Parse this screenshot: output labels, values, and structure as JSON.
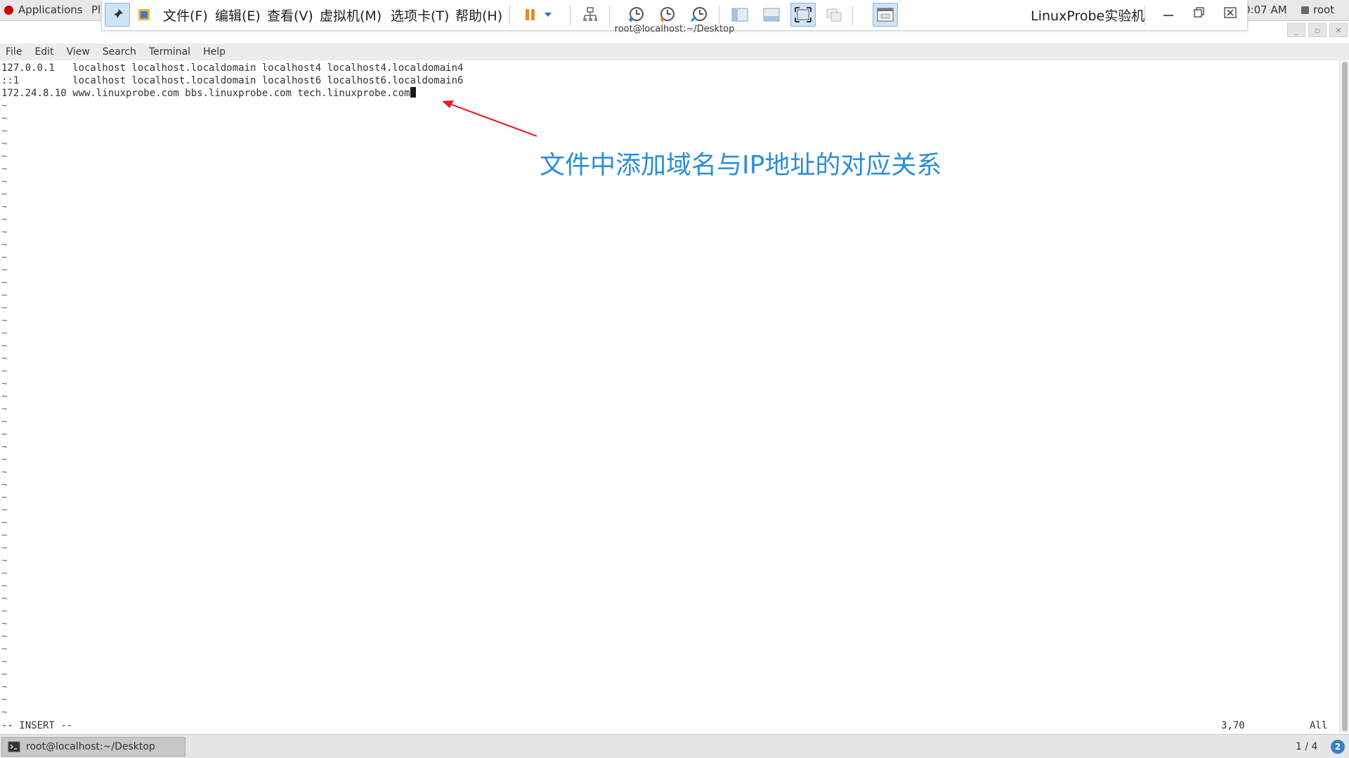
{
  "topbar": {
    "applications_label": "Applications",
    "places_label": "Pl",
    "clock": "0:07 AM",
    "user": "root"
  },
  "vm_toolbar": {
    "menus": [
      "文件(F)",
      "编辑(E)",
      "查看(V)",
      "虚拟机(M)",
      "选项卡(T)",
      "帮助(H)"
    ],
    "title": "LinuxProbe实验机"
  },
  "terminal": {
    "window_title": "root@localhost:~/Desktop",
    "menubar": [
      "File",
      "Edit",
      "View",
      "Search",
      "Terminal",
      "Help"
    ],
    "lines": [
      "127.0.0.1   localhost localhost.localdomain localhost4 localhost4.localdomain4",
      "::1         localhost localhost.localdomain localhost6 localhost6.localdomain6",
      "172.24.8.10 www.linuxprobe.com bbs.linuxprobe.com tech.linuxprobe.com"
    ],
    "status_mode": "-- INSERT --",
    "cursor_position": "3,70",
    "scroll_position": "All"
  },
  "annotation": {
    "text": "文件中添加域名与IP地址的对应关系",
    "color": "#2b8fd6",
    "arrow_color": "#e02020"
  },
  "taskbar": {
    "task_label": "root@localhost:~/Desktop",
    "workspace": "1 / 4",
    "help_badge": "2"
  }
}
